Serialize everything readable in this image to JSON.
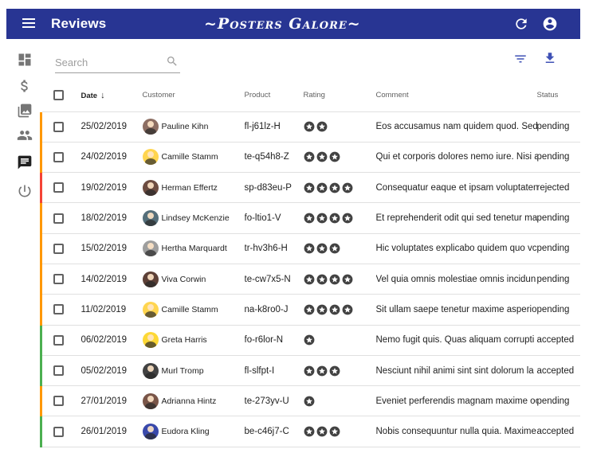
{
  "appbar": {
    "title": "Reviews",
    "brand": "~Posters Galore~"
  },
  "search": {
    "placeholder": "Search"
  },
  "columns": {
    "date": "Date",
    "customer": "Customer",
    "product": "Product",
    "rating": "Rating",
    "comment": "Comment",
    "status": "Status"
  },
  "colors": {
    "appbar": "#283593",
    "pending": "#ff9800",
    "accepted": "#4caf50",
    "rejected": "#f44336"
  },
  "rows": [
    {
      "date": "25/02/2019",
      "customer": "Pauline Kihn",
      "avatar_color": "#8d6e63",
      "product": "fl-j61lz-H",
      "rating": 2,
      "comment": "Eos accusamus nam quidem quod. Sed",
      "status": "pending"
    },
    {
      "date": "24/02/2019",
      "customer": "Camille Stamm",
      "avatar_color": "#ffd54f",
      "product": "te-q54h8-Z",
      "rating": 3,
      "comment": "Qui et corporis dolores nemo iure. Nisi a",
      "status": "pending"
    },
    {
      "date": "19/02/2019",
      "customer": "Herman Effertz",
      "avatar_color": "#6d4c41",
      "product": "sp-d83eu-P",
      "rating": 4,
      "comment": "Consequatur eaque et ipsam voluptaten",
      "status": "rejected"
    },
    {
      "date": "18/02/2019",
      "customer": "Lindsey McKenzie",
      "avatar_color": "#546e7a",
      "product": "fo-ltio1-V",
      "rating": 4,
      "comment": "Et reprehenderit odit qui sed tenetur ma",
      "status": "pending"
    },
    {
      "date": "15/02/2019",
      "customer": "Hertha Marquardt",
      "avatar_color": "#9e9e9e",
      "product": "tr-hv3h6-H",
      "rating": 3,
      "comment": "Hic voluptates explicabo quidem quo vc",
      "status": "pending"
    },
    {
      "date": "14/02/2019",
      "customer": "Viva Corwin",
      "avatar_color": "#5d4037",
      "product": "te-cw7x5-N",
      "rating": 4,
      "comment": "Vel quia omnis molestiae omnis incidun",
      "status": "pending"
    },
    {
      "date": "11/02/2019",
      "customer": "Camille Stamm",
      "avatar_color": "#ffd54f",
      "product": "na-k8ro0-J",
      "rating": 4,
      "comment": "Sit ullam saepe tenetur maxime asperio",
      "status": "pending"
    },
    {
      "date": "06/02/2019",
      "customer": "Greta Harris",
      "avatar_color": "#fdd835",
      "product": "fo-r6lor-N",
      "rating": 1,
      "comment": "Nemo fugit quis. Quas aliquam corrupti",
      "status": "accepted"
    },
    {
      "date": "05/02/2019",
      "customer": "Murl Tromp",
      "avatar_color": "#424242",
      "product": "fl-slfpt-I",
      "rating": 3,
      "comment": "Nesciunt nihil animi sint sint dolorum la",
      "status": "accepted"
    },
    {
      "date": "27/01/2019",
      "customer": "Adrianna Hintz",
      "avatar_color": "#795548",
      "product": "te-273yv-U",
      "rating": 1,
      "comment": "Eveniet perferendis magnam maxime oc",
      "status": "pending"
    },
    {
      "date": "26/01/2019",
      "customer": "Eudora Kling",
      "avatar_color": "#3949ab",
      "product": "be-c46j7-C",
      "rating": 3,
      "comment": "Nobis consequuntur nulla quia. Maxime a",
      "status": "accepted"
    }
  ]
}
